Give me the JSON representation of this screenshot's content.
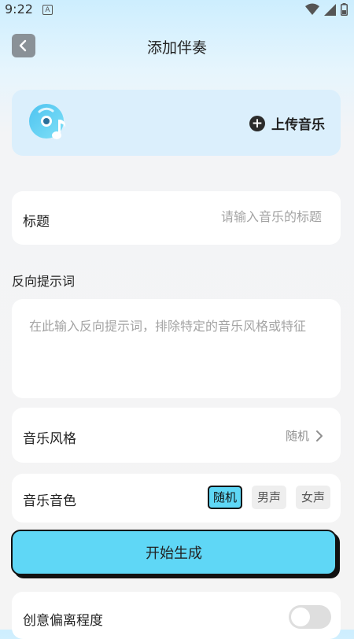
{
  "status_bar": {
    "time": "9:22",
    "notification_letter": "A",
    "icons": [
      "wifi-icon",
      "signal-icon",
      "battery-icon"
    ]
  },
  "nav": {
    "title": "添加伴奏",
    "back_icon": "chevron-left-icon"
  },
  "upload": {
    "icon": "music-disc-icon",
    "plus_icon": "plus-circle-icon",
    "label": "上传音乐"
  },
  "title_field": {
    "label": "标题",
    "placeholder": "请输入音乐的标题",
    "value": ""
  },
  "negative_prompt": {
    "label": "反向提示词",
    "placeholder": "在此输入反向提示词，排除特定的音乐风格或特征",
    "value": ""
  },
  "music_style": {
    "label": "音乐风格",
    "value": "随机",
    "chevron_icon": "chevron-right-icon"
  },
  "music_timbre": {
    "label": "音乐音色",
    "options": [
      "随机",
      "男声",
      "女声"
    ],
    "selected": "随机"
  },
  "start_button": {
    "label": "开始生成"
  },
  "creativity": {
    "label": "创意偏离程度",
    "enabled": false
  },
  "colors": {
    "accent": "#5fd7f6",
    "upload_card_bg": "#dbeffc",
    "back_button_bg": "#8a9197"
  }
}
